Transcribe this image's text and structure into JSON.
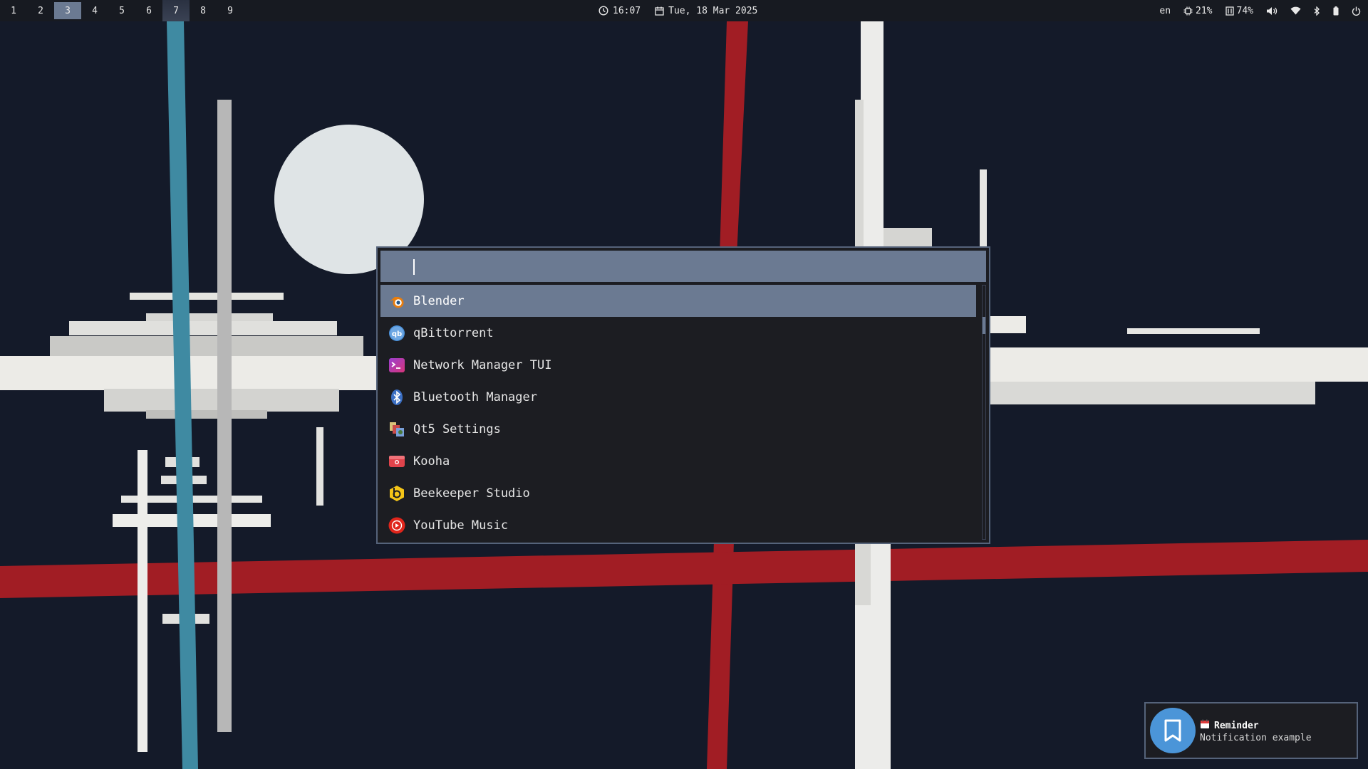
{
  "topbar": {
    "workspaces": [
      {
        "label": "1",
        "state": "empty"
      },
      {
        "label": "2",
        "state": "empty"
      },
      {
        "label": "3",
        "state": "active"
      },
      {
        "label": "4",
        "state": "empty"
      },
      {
        "label": "5",
        "state": "empty"
      },
      {
        "label": "6",
        "state": "empty"
      },
      {
        "label": "7",
        "state": "occupied"
      },
      {
        "label": "8",
        "state": "empty"
      },
      {
        "label": "9",
        "state": "empty"
      }
    ],
    "clock": {
      "icon": "clock-icon",
      "time": "16:07"
    },
    "date": {
      "icon": "calendar-icon",
      "text": "Tue, 18 Mar 2025"
    },
    "language": "en",
    "cpu": {
      "icon": "cpu-icon",
      "value": "21%"
    },
    "memory": {
      "icon": "memory-icon",
      "value": "74%"
    },
    "tray_icons": [
      "volume-icon",
      "wifi-icon",
      "bluetooth-icon",
      "battery-icon",
      "power-icon"
    ]
  },
  "launcher": {
    "query": "",
    "items": [
      {
        "label": "Blender",
        "icon": "blender-icon",
        "selected": true
      },
      {
        "label": "qBittorrent",
        "icon": "qbittorrent-icon",
        "selected": false
      },
      {
        "label": "Network Manager TUI",
        "icon": "terminal-icon",
        "selected": false
      },
      {
        "label": "Bluetooth Manager",
        "icon": "bluetooth-manager-icon",
        "selected": false
      },
      {
        "label": "Qt5 Settings",
        "icon": "qt5-settings-icon",
        "selected": false
      },
      {
        "label": "Kooha",
        "icon": "kooha-icon",
        "selected": false
      },
      {
        "label": "Beekeeper Studio",
        "icon": "beekeeper-icon",
        "selected": false
      },
      {
        "label": "YouTube Music",
        "icon": "youtube-music-icon",
        "selected": false
      }
    ]
  },
  "notification": {
    "icon": "bookmark-icon",
    "title_icon": "calendar-emoji-icon",
    "title": "Reminder",
    "body": "Notification example"
  },
  "colors": {
    "bar_bg": "#171a21",
    "accent": "#6b7a92",
    "launcher_bg": "#1c1d22",
    "border": "#55637a",
    "wallpaper_bg": "#141a29",
    "wallpaper_red": "#a11d24",
    "wallpaper_blue": "#3f8aa2",
    "notification_avatar": "#4b95d8"
  }
}
